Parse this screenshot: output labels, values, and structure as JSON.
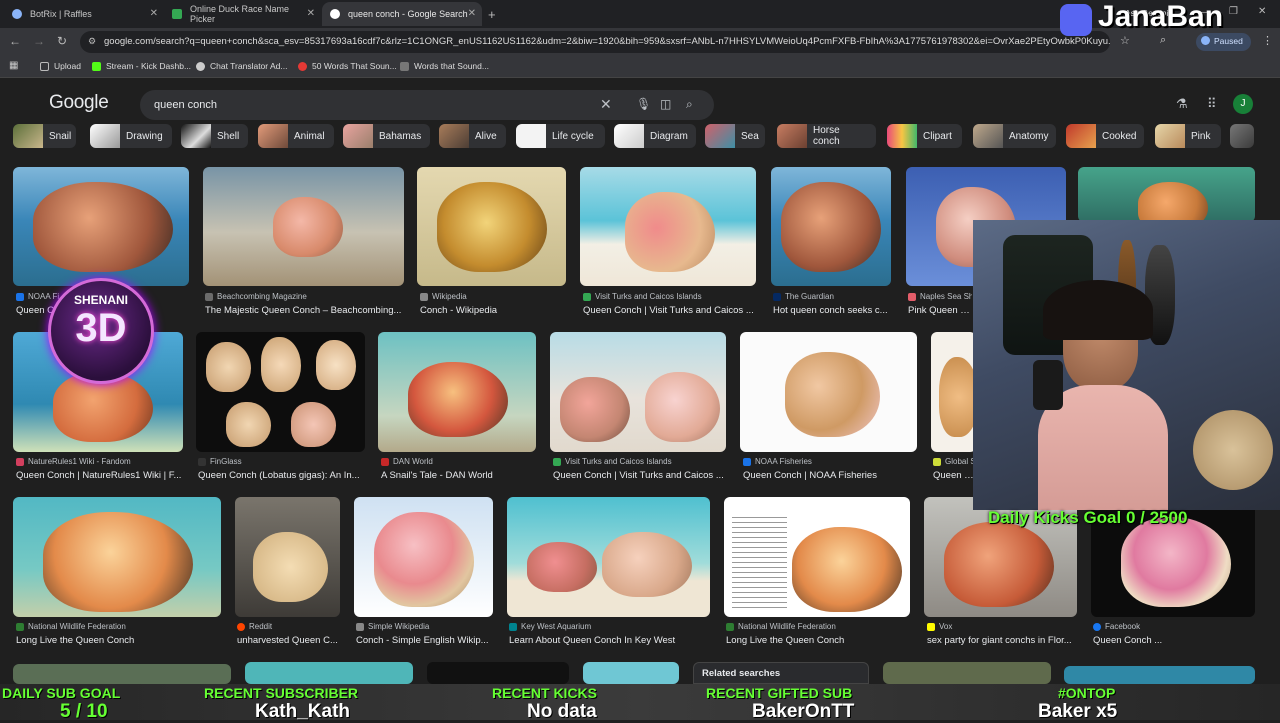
{
  "browser": {
    "tabs": [
      {
        "title": "BotRix | Raffles"
      },
      {
        "title": "Online Duck Race Name Picker"
      },
      {
        "title": "queen conch - Google Search"
      }
    ],
    "url": "google.com/search?q=queen+conch&sca_esv=85317693a16cdf7c&rlz=1C1ONGR_enUS1162US1162&udm=2&biw=1920&bih=959&sxsrf=ANbL-n7HHSYLVMWeioUq4PcmFXFB-FbIhA%3A1775761978302&ei=OvrXae2PEtyOwbkP0Kuyu...",
    "paused_label": "Paused",
    "ask_gemini": "Ask Gemini",
    "bookmarks": [
      "Upload",
      "Stream - Kick Dashb...",
      "Chat Translator Ad...",
      "50 Words That Soun...",
      "Words that Sound..."
    ]
  },
  "search": {
    "logo": "Google",
    "query": "queen conch",
    "avatar_letter": "J"
  },
  "chips": [
    "Snail",
    "Drawing",
    "Shell",
    "Animal",
    "Bahamas",
    "Alive",
    "Life cycle",
    "Diagram",
    "Sea",
    "Horse conch",
    "Clipart",
    "Anatomy",
    "Cooked",
    "Pink"
  ],
  "results": [
    {
      "source": "NOAA Fi...",
      "title": "Queen C..."
    },
    {
      "source": "Beachcombing Magazine",
      "title": "The Majestic Queen Conch – Beachcombing..."
    },
    {
      "source": "Wikipedia",
      "title": "Conch - Wikipedia"
    },
    {
      "source": "Visit Turks and Caicos Islands",
      "title": "Queen Conch | Visit Turks and Caicos ..."
    },
    {
      "source": "The Guardian",
      "title": "Hot queen conch seeks c..."
    },
    {
      "source": "Naples Sea Sh...",
      "title": "Pink Queen Con..."
    },
    {
      "source": "NatureRules1 Wiki - Fandom",
      "title": "Queen Conch | NatureRules1 Wiki | F..."
    },
    {
      "source": "FinGlass",
      "title": "Queen Conch (Lobatus gigas): An In..."
    },
    {
      "source": "DAN World",
      "title": "A Snail's Tale - DAN World"
    },
    {
      "source": "Visit Turks and Caicos Islands",
      "title": "Queen Conch | Visit Turks and Caicos ..."
    },
    {
      "source": "NOAA Fisheries",
      "title": "Queen Conch | NOAA Fisheries"
    },
    {
      "source": "Global S...",
      "title": "Queen co..."
    },
    {
      "source": "National Wildlife Federation",
      "title": "Long Live the Queen Conch"
    },
    {
      "source": "Reddit",
      "title": "unharvested Queen C..."
    },
    {
      "source": "Simple Wikipedia",
      "title": "Conch - Simple English Wikip..."
    },
    {
      "source": "Key West Aquarium",
      "title": "Learn About Queen Conch In Key West"
    },
    {
      "source": "National Wildlife Federation",
      "title": "Long Live the Queen Conch"
    },
    {
      "source": "Vox",
      "title": "sex party for giant conchs in Flor..."
    },
    {
      "source": "Facebook",
      "title": "Queen Conch ..."
    }
  ],
  "related_searches": "Related searches",
  "overlay": {
    "streamer": "JanaBan",
    "shenani_top": "SHENANI",
    "shenani_main": "3D",
    "daily_kicks": "Daily Kicks Goal 0 / 2500",
    "bar": [
      {
        "label": "DAILY SUB GOAL",
        "value": "5 / 10"
      },
      {
        "label": "RECENT SUBSCRIBER",
        "value": "Kath_Kath"
      },
      {
        "label": "RECENT KICKS",
        "value": "No data"
      },
      {
        "label": "RECENT GIFTED SUB",
        "value": "BakerOnTT"
      },
      {
        "label": "#ONTOP",
        "value": "Baker x5"
      }
    ]
  }
}
